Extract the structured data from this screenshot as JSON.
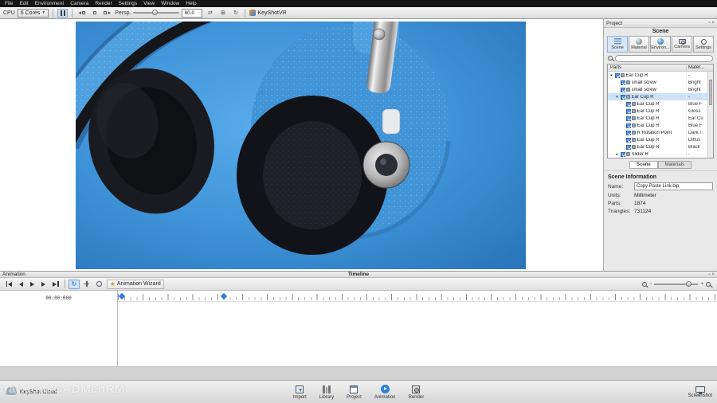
{
  "menu": {
    "items": [
      "File",
      "Edit",
      "Environment",
      "Camera",
      "Render",
      "Settings",
      "View",
      "Window",
      "Help"
    ]
  },
  "toolbar": {
    "cpu_label": "CPU",
    "cores_value": "6 Cores",
    "persp_label": "Persp.",
    "focal_value": "80.0",
    "keyshotvr_label": "KeyShotVR"
  },
  "project_panel": {
    "title": "Project",
    "header": "Scene",
    "tabs": [
      {
        "label": "Scene"
      },
      {
        "label": "Material"
      },
      {
        "label": "Environ..."
      },
      {
        "label": "Camera"
      },
      {
        "label": "Settings"
      }
    ],
    "columns": {
      "parts": "Parts",
      "material": "Mater..."
    },
    "tree": [
      {
        "label": "Ear Cup R",
        "material": "-"
      },
      {
        "label": "small screw",
        "material": "Bright"
      },
      {
        "label": "small screw",
        "material": "Bright"
      },
      {
        "label": "Ear Cup R",
        "material": "-"
      },
      {
        "label": "Ear Cup R",
        "material": "Blue F"
      },
      {
        "label": "Ear Cup R",
        "material": "Gloss"
      },
      {
        "label": "Ear Cup R",
        "material": "Ear Cu"
      },
      {
        "label": "Ear Cup R",
        "material": "Blue F"
      },
      {
        "label": "R Rotation Point",
        "material": "Dark r"
      },
      {
        "label": "Ear Cup R",
        "material": "Diffus"
      },
      {
        "label": "Ear Cup R",
        "material": "Black"
      },
      {
        "label": "Slider R",
        "material": "-"
      }
    ],
    "bottom_tabs": [
      {
        "label": "Scene"
      },
      {
        "label": "Materials"
      }
    ],
    "scene_info": {
      "title": "Scene Information",
      "name_label": "Name:",
      "name_value": "Copy Paste Link.bip",
      "units_label": "Units:",
      "units_value": "Millimeter",
      "parts_label": "Parts:",
      "parts_value": "1874",
      "triangles_label": "Triangles:",
      "triangles_value": "731124"
    }
  },
  "animation": {
    "panel_title": "Animation",
    "timeline_title": "Timeline",
    "wizard_label": "Animation Wizard",
    "timecode": "00:00:000"
  },
  "bottom_bar": {
    "cloud_label": "KeyShot Cloud",
    "items": [
      {
        "label": "Import"
      },
      {
        "label": "Library"
      },
      {
        "label": "Project"
      },
      {
        "label": "Animation"
      },
      {
        "label": "Render"
      }
    ],
    "screenshot_label": "Screenshot"
  },
  "watermark": "arat.com/CADMenRM",
  "colors": {
    "accent": "#2f7fe0",
    "viewport_blue": "#3f93d6"
  }
}
